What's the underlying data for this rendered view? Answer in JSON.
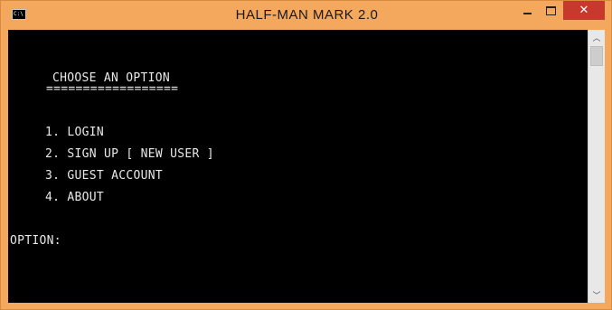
{
  "window": {
    "title": "HALF-MAN  MARK  2.0",
    "icon_label": "C:\\",
    "controls": {
      "minimize": "minimize-icon",
      "maximize": "maximize-icon",
      "close": "close-icon",
      "close_glyph": "✕"
    },
    "colors": {
      "frame": "#f3a85d",
      "close": "#c7392c",
      "console_bg": "#000000",
      "console_fg": "#e8e8e8"
    }
  },
  "console": {
    "heading": "CHOOSE AN OPTION",
    "underline": "==================",
    "menu": [
      "1. LOGIN",
      "2. SIGN UP [ NEW USER ]",
      "3. GUEST ACCOUNT",
      "4. ABOUT"
    ],
    "prompt": "OPTION:"
  },
  "scrollbar": {
    "up_glyph": "︿",
    "down_glyph": "﹀"
  }
}
